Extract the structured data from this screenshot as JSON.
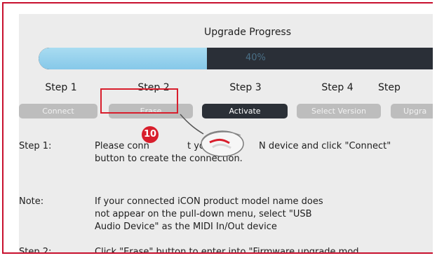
{
  "window": {
    "title": "Upgrade Progress"
  },
  "progress": {
    "value": 0.4,
    "label": "40%"
  },
  "steps": [
    {
      "label": "Step 1",
      "button": "Connect",
      "state": "disabled"
    },
    {
      "label": "Step 2",
      "button": "Erase",
      "state": "disabled"
    },
    {
      "label": "Step 3",
      "button": "Activate",
      "state": "active"
    },
    {
      "label": "Step 4",
      "button": "Select Version",
      "state": "disabled"
    },
    {
      "label": "Step",
      "button": "Upgra",
      "state": "disabled"
    }
  ],
  "instructions": [
    {
      "key": "Step 1:",
      "lines": [
        "Please conn",
        "t you",
        "N device and click \"Connect\"",
        "button to create the connection."
      ]
    },
    {
      "key": "Note:",
      "lines": [
        "If your connected iCON product model name does",
        "not appear on the pull-down menu, select \"USB",
        "Audio Device\" as the MIDI In/Out device"
      ]
    },
    {
      "key": "Step 2:",
      "lines": [
        "Click \"Erase\" button to enter into \"Firmware upgrade mod"
      ]
    }
  ],
  "annotation": {
    "badge_number": "10",
    "color": "#d81e2c"
  },
  "colors": {
    "accent_red": "#c8102e",
    "progress_fill": "#86c8e9",
    "progress_track": "#2a2f37",
    "active_button": "#2b3037",
    "disabled_button": "#bdbdbd"
  }
}
